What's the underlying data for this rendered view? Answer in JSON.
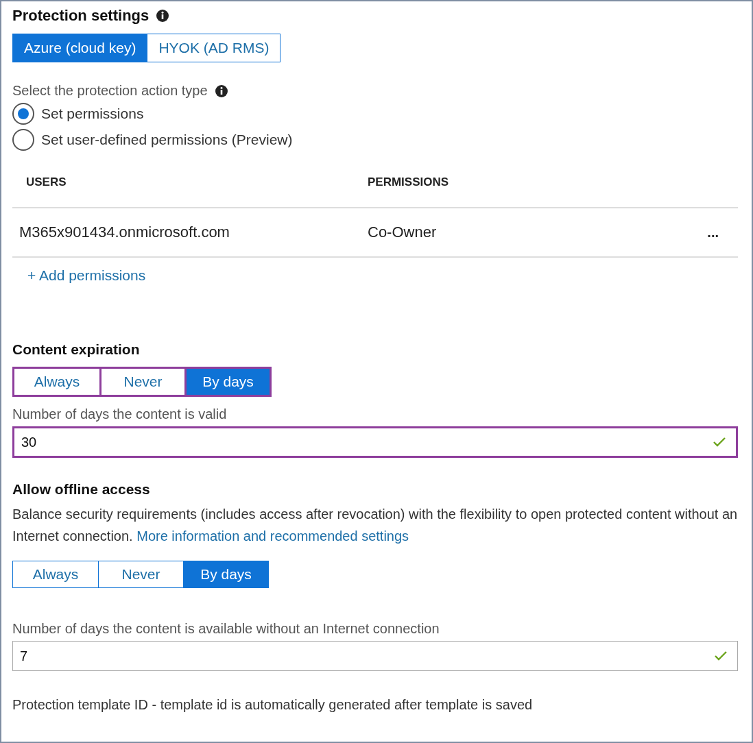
{
  "protection_settings": {
    "title": "Protection settings",
    "key_tabs": [
      {
        "label": "Azure (cloud key)",
        "selected": true
      },
      {
        "label": "HYOK (AD RMS)",
        "selected": false
      }
    ]
  },
  "action_type": {
    "label": "Select the protection action type",
    "options": [
      {
        "label": "Set permissions",
        "selected": true
      },
      {
        "label": "Set user-defined permissions (Preview)",
        "selected": false
      }
    ]
  },
  "table": {
    "columns": [
      "USERS",
      "PERMISSIONS"
    ],
    "rows": [
      {
        "user": "M365x901434.onmicrosoft.com",
        "permission": "Co-Owner",
        "menu": "..."
      }
    ],
    "add_link": "+ Add permissions"
  },
  "content_expiration": {
    "title": "Content expiration",
    "highlighted": true,
    "options": [
      {
        "label": "Always",
        "selected": false
      },
      {
        "label": "Never",
        "selected": false
      },
      {
        "label": "By days",
        "selected": true
      }
    ],
    "field": {
      "label": "Number of days the content is valid",
      "value": "30",
      "valid": true,
      "highlighted": true
    }
  },
  "offline_access": {
    "title": "Allow offline access",
    "description": "Balance security requirements (includes access after revocation) with the flexibility to open protected content without an Internet connection.",
    "link": "More information and recommended settings",
    "highlighted": false,
    "options": [
      {
        "label": "Always",
        "selected": false
      },
      {
        "label": "Never",
        "selected": false
      },
      {
        "label": "By days",
        "selected": true
      }
    ],
    "field": {
      "label": "Number of days the content is available without an Internet connection",
      "value": "7",
      "valid": true,
      "highlighted": false
    }
  },
  "footer": "Protection template ID - template id is automatically generated after template is saved"
}
